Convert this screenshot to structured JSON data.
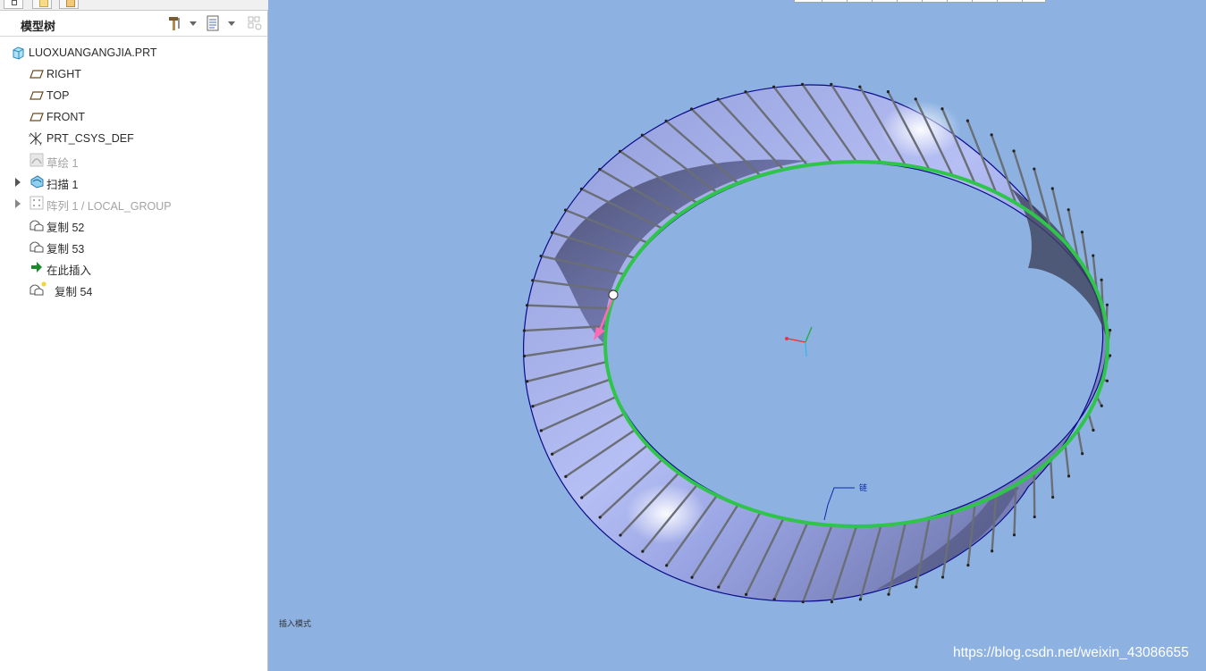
{
  "panel": {
    "title": "模型树",
    "tabs": [
      "model-tree-tab",
      "folder-tab",
      "layer-tab"
    ]
  },
  "tree": {
    "items": [
      {
        "label": "LUOXUANGANGJIA.PRT",
        "icon": "part-icon",
        "expandable": false,
        "dimmed": false
      },
      {
        "label": "RIGHT",
        "icon": "datum-plane-icon",
        "expandable": false,
        "dimmed": false
      },
      {
        "label": "TOP",
        "icon": "datum-plane-icon",
        "expandable": false,
        "dimmed": false
      },
      {
        "label": "FRONT",
        "icon": "datum-plane-icon",
        "expandable": false,
        "dimmed": false
      },
      {
        "label": "PRT_CSYS_DEF",
        "icon": "csys-icon",
        "expandable": false,
        "dimmed": false
      },
      {
        "label": "草绘 1",
        "icon": "sketch-icon",
        "expandable": false,
        "dimmed": true
      },
      {
        "label": "扫描 1",
        "icon": "sweep-icon",
        "expandable": true,
        "dimmed": false
      },
      {
        "label": "阵列 1 / LOCAL_GROUP",
        "icon": "pattern-icon",
        "expandable": true,
        "dimmed": true
      },
      {
        "label": "复制 52",
        "icon": "copy-surface-icon",
        "expandable": false,
        "dimmed": false
      },
      {
        "label": "复制 53",
        "icon": "copy-surface-icon",
        "expandable": false,
        "dimmed": false
      },
      {
        "label": "在此插入",
        "icon": "insert-here-arrow-icon",
        "expandable": false,
        "dimmed": false
      },
      {
        "label": "复制 54",
        "icon": "copy-surface-new-icon",
        "expandable": false,
        "dimmed": false
      }
    ]
  },
  "viewport": {
    "mode_label": "插入模式",
    "edge_label": "链",
    "watermark": "https://blog.csdn.net/weixin_43086655",
    "background_color": "#8db2e2",
    "chain_color": "#2fc44a",
    "surface_color": "#a9b4ef"
  }
}
